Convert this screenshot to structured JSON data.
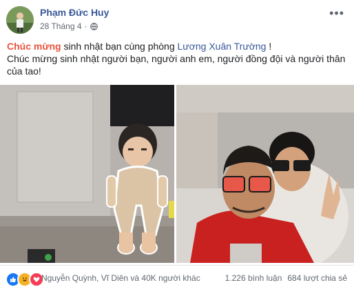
{
  "post": {
    "author": "Phạm Đức Huy",
    "date": "28 Tháng 4",
    "separator": "·",
    "more_label": "•••",
    "line1_highlight": "Chúc mừng",
    "line1_text": " sinh nhật bạn cùng phòng ",
    "line1_link": "Lương Xuân Trường",
    "line1_end": " !",
    "line2": "Chúc mừng sinh nhật người bạn, người anh em, người đồng đội và người thân của tao!"
  },
  "footer": {
    "reactions_text": "Nguyễn Quỳnh, Vĩ Diên và 40K người khác",
    "comments": "1.226 bình luận",
    "shares": "684 lượt chia sẻ",
    "reaction_icons": [
      "like-icon",
      "haha-icon",
      "love-icon"
    ]
  },
  "colors": {
    "link": "#385898",
    "highlight": "#e9543d",
    "like": "#1877f2",
    "haha": "#f7b125",
    "love": "#f33e58"
  }
}
